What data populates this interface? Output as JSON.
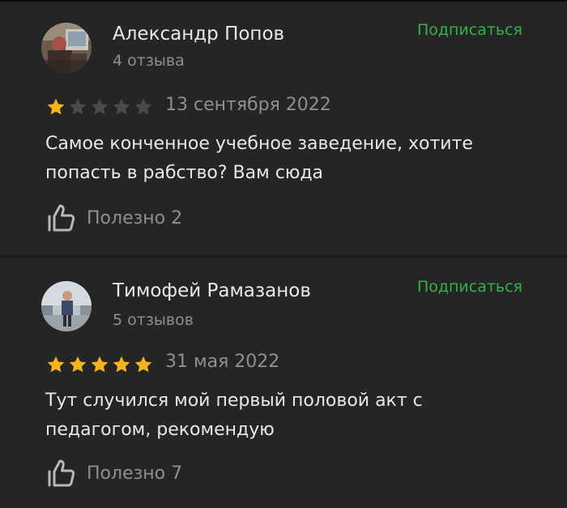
{
  "reviews": [
    {
      "author": "Александр Попов",
      "review_count": "4 отзыва",
      "subscribe_label": "Подписаться",
      "rating": 1,
      "max_rating": 5,
      "date": "13 сентября 2022",
      "text": "Самое конченное учебное заведение, хотите попасть в рабство? Вам сюда",
      "useful_label": "Полезно 2"
    },
    {
      "author": "Тимофей Рамазанов",
      "review_count": "5 отзывов",
      "subscribe_label": "Подписаться",
      "rating": 5,
      "max_rating": 5,
      "date": "31 мая 2022",
      "text": "Тут случился мой первый половой акт с педагогом, рекомендую",
      "useful_label": "Полезно 7"
    }
  ],
  "colors": {
    "accent": "#33b24a",
    "star_filled": "#f5b41e",
    "star_empty": "#4a4a4a",
    "text_primary": "#e8e8e8",
    "text_secondary": "#8f8f8f",
    "background": "#252525"
  },
  "icons": {
    "like": "thumbs-up-icon",
    "star": "star-icon"
  }
}
